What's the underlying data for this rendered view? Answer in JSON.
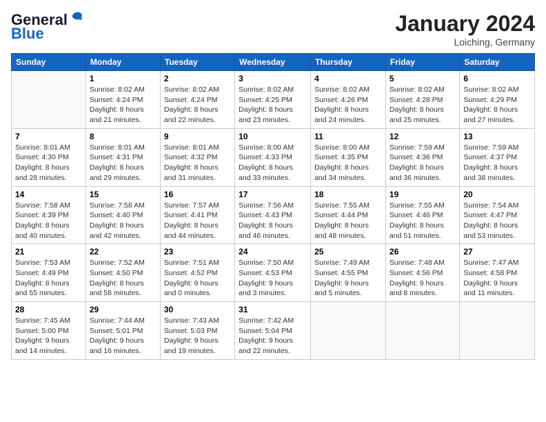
{
  "header": {
    "logo_general": "General",
    "logo_blue": "Blue",
    "month": "January 2024",
    "location": "Loiching, Germany"
  },
  "days_of_week": [
    "Sunday",
    "Monday",
    "Tuesday",
    "Wednesday",
    "Thursday",
    "Friday",
    "Saturday"
  ],
  "weeks": [
    [
      {
        "day": "",
        "info": ""
      },
      {
        "day": "1",
        "info": "Sunrise: 8:02 AM\nSunset: 4:24 PM\nDaylight: 8 hours\nand 21 minutes."
      },
      {
        "day": "2",
        "info": "Sunrise: 8:02 AM\nSunset: 4:24 PM\nDaylight: 8 hours\nand 22 minutes."
      },
      {
        "day": "3",
        "info": "Sunrise: 8:02 AM\nSunset: 4:25 PM\nDaylight: 8 hours\nand 23 minutes."
      },
      {
        "day": "4",
        "info": "Sunrise: 8:02 AM\nSunset: 4:26 PM\nDaylight: 8 hours\nand 24 minutes."
      },
      {
        "day": "5",
        "info": "Sunrise: 8:02 AM\nSunset: 4:28 PM\nDaylight: 8 hours\nand 25 minutes."
      },
      {
        "day": "6",
        "info": "Sunrise: 8:02 AM\nSunset: 4:29 PM\nDaylight: 8 hours\nand 27 minutes."
      }
    ],
    [
      {
        "day": "7",
        "info": "Sunrise: 8:01 AM\nSunset: 4:30 PM\nDaylight: 8 hours\nand 28 minutes."
      },
      {
        "day": "8",
        "info": "Sunrise: 8:01 AM\nSunset: 4:31 PM\nDaylight: 8 hours\nand 29 minutes."
      },
      {
        "day": "9",
        "info": "Sunrise: 8:01 AM\nSunset: 4:32 PM\nDaylight: 8 hours\nand 31 minutes."
      },
      {
        "day": "10",
        "info": "Sunrise: 8:00 AM\nSunset: 4:33 PM\nDaylight: 8 hours\nand 33 minutes."
      },
      {
        "day": "11",
        "info": "Sunrise: 8:00 AM\nSunset: 4:35 PM\nDaylight: 8 hours\nand 34 minutes."
      },
      {
        "day": "12",
        "info": "Sunrise: 7:59 AM\nSunset: 4:36 PM\nDaylight: 8 hours\nand 36 minutes."
      },
      {
        "day": "13",
        "info": "Sunrise: 7:59 AM\nSunset: 4:37 PM\nDaylight: 8 hours\nand 38 minutes."
      }
    ],
    [
      {
        "day": "14",
        "info": "Sunrise: 7:58 AM\nSunset: 4:39 PM\nDaylight: 8 hours\nand 40 minutes."
      },
      {
        "day": "15",
        "info": "Sunrise: 7:58 AM\nSunset: 4:40 PM\nDaylight: 8 hours\nand 42 minutes."
      },
      {
        "day": "16",
        "info": "Sunrise: 7:57 AM\nSunset: 4:41 PM\nDaylight: 8 hours\nand 44 minutes."
      },
      {
        "day": "17",
        "info": "Sunrise: 7:56 AM\nSunset: 4:43 PM\nDaylight: 8 hours\nand 46 minutes."
      },
      {
        "day": "18",
        "info": "Sunrise: 7:55 AM\nSunset: 4:44 PM\nDaylight: 8 hours\nand 48 minutes."
      },
      {
        "day": "19",
        "info": "Sunrise: 7:55 AM\nSunset: 4:46 PM\nDaylight: 8 hours\nand 51 minutes."
      },
      {
        "day": "20",
        "info": "Sunrise: 7:54 AM\nSunset: 4:47 PM\nDaylight: 8 hours\nand 53 minutes."
      }
    ],
    [
      {
        "day": "21",
        "info": "Sunrise: 7:53 AM\nSunset: 4:49 PM\nDaylight: 8 hours\nand 55 minutes."
      },
      {
        "day": "22",
        "info": "Sunrise: 7:52 AM\nSunset: 4:50 PM\nDaylight: 8 hours\nand 58 minutes."
      },
      {
        "day": "23",
        "info": "Sunrise: 7:51 AM\nSunset: 4:52 PM\nDaylight: 9 hours\nand 0 minutes."
      },
      {
        "day": "24",
        "info": "Sunrise: 7:50 AM\nSunset: 4:53 PM\nDaylight: 9 hours\nand 3 minutes."
      },
      {
        "day": "25",
        "info": "Sunrise: 7:49 AM\nSunset: 4:55 PM\nDaylight: 9 hours\nand 5 minutes."
      },
      {
        "day": "26",
        "info": "Sunrise: 7:48 AM\nSunset: 4:56 PM\nDaylight: 9 hours\nand 8 minutes."
      },
      {
        "day": "27",
        "info": "Sunrise: 7:47 AM\nSunset: 4:58 PM\nDaylight: 9 hours\nand 11 minutes."
      }
    ],
    [
      {
        "day": "28",
        "info": "Sunrise: 7:45 AM\nSunset: 5:00 PM\nDaylight: 9 hours\nand 14 minutes."
      },
      {
        "day": "29",
        "info": "Sunrise: 7:44 AM\nSunset: 5:01 PM\nDaylight: 9 hours\nand 16 minutes."
      },
      {
        "day": "30",
        "info": "Sunrise: 7:43 AM\nSunset: 5:03 PM\nDaylight: 9 hours\nand 19 minutes."
      },
      {
        "day": "31",
        "info": "Sunrise: 7:42 AM\nSunset: 5:04 PM\nDaylight: 9 hours\nand 22 minutes."
      },
      {
        "day": "",
        "info": ""
      },
      {
        "day": "",
        "info": ""
      },
      {
        "day": "",
        "info": ""
      }
    ]
  ]
}
